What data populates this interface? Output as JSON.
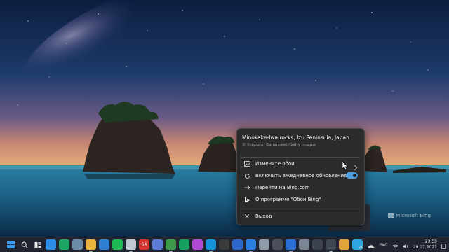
{
  "wallpaper": {
    "credit_watermark": "Microsoft Bing"
  },
  "menu": {
    "title": "Minokake-Iwa rocks, Izu Peninsula, Japan",
    "credit": "© Krzysztof Baranowski/Getty Images",
    "items": [
      {
        "label": "Измените обои",
        "icon": "picture-icon",
        "right": "chevron-right-icon"
      },
      {
        "label": "Включить ежедневное обновление",
        "icon": "refresh-icon",
        "right": "toggle-on"
      },
      {
        "label": "Перейти на Bing.com",
        "icon": "arrow-right-icon"
      },
      {
        "label": "О программе \"Обои Bing\"",
        "icon": "bing-logo-icon"
      },
      {
        "label": "Выход",
        "icon": "close-icon"
      }
    ],
    "toggle_state": "on",
    "accent": "#4ca0e0"
  },
  "taskbar": {
    "apps": [
      {
        "name": "start-icon",
        "color": "#3b9cf3"
      },
      {
        "name": "search-icon",
        "color": "#1f2430"
      },
      {
        "name": "task-view-icon",
        "color": "#1f2430"
      },
      {
        "name": "widgets-icon",
        "color": "#2d8ce6"
      },
      {
        "name": "edge-icon",
        "color": "#1fa463"
      },
      {
        "name": "recycle-bin-icon",
        "color": "#6c8ba6"
      },
      {
        "name": "explorer-icon",
        "color": "#e8b33b"
      },
      {
        "name": "mail-icon",
        "color": "#2f7fd3"
      },
      {
        "name": "spotify-icon",
        "color": "#1db954"
      },
      {
        "name": "phone-icon",
        "color": "#c0c8d4"
      },
      {
        "name": "app-64-icon",
        "color": "#d0312d",
        "text": "64"
      },
      {
        "name": "photos-icon",
        "color": "#5b7bd6"
      },
      {
        "name": "notepad-plus-icon",
        "color": "#3c9b4a"
      },
      {
        "name": "sheets-icon",
        "color": "#17a05d"
      },
      {
        "name": "paint-icon",
        "color": "#b04ad6"
      },
      {
        "name": "skype-icon",
        "color": "#1592d8"
      },
      {
        "name": "terminal-icon",
        "color": "#3a3a3a"
      },
      {
        "name": "word-icon",
        "color": "#2b66c8"
      },
      {
        "name": "blue-app-icon",
        "color": "#2a7de1"
      },
      {
        "name": "trash-icon",
        "color": "#8e9aa8"
      },
      {
        "name": "camera-icon",
        "color": "#4a4f5a"
      },
      {
        "name": "store-icon",
        "color": "#2b6fd6"
      },
      {
        "name": "settings-icon",
        "color": "#7c8594"
      },
      {
        "name": "calendar-icon",
        "color": "#3c4150"
      },
      {
        "name": "music-icon",
        "color": "#404552"
      },
      {
        "name": "folder-icon",
        "color": "#e0a53a"
      },
      {
        "name": "image-icon",
        "color": "#2ea5de"
      }
    ],
    "tray": {
      "language": "РУС",
      "time": "23:59",
      "date": "29.07.2021"
    }
  }
}
